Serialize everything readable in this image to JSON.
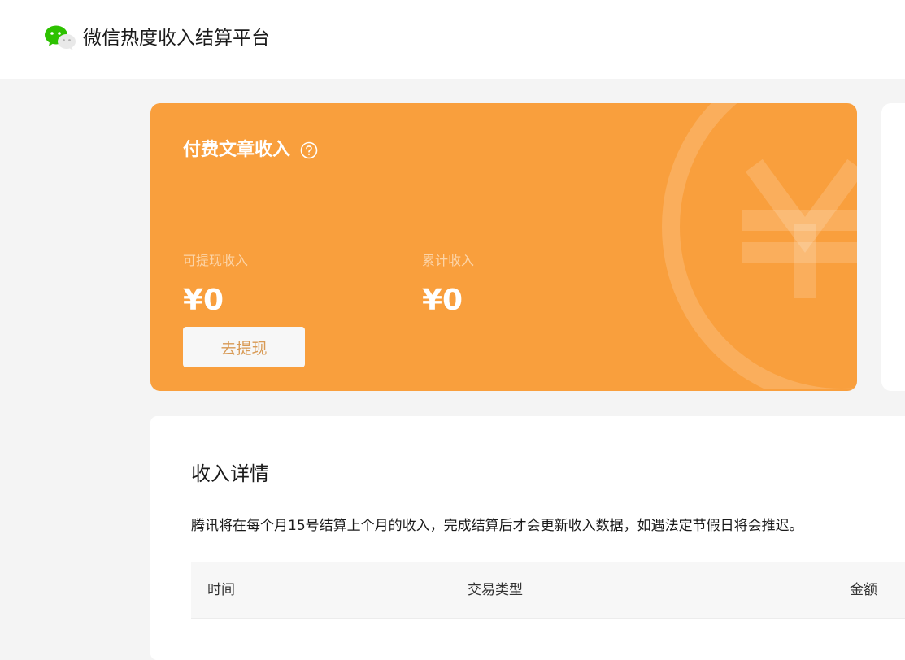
{
  "header": {
    "logo_icon": "wechat-logo-icon",
    "title": "微信热度收入结算平台"
  },
  "income_card": {
    "title": "付费文章收入",
    "help_icon": "question-circle-icon",
    "background_color": "#f99f3d",
    "watermark_icon": "yen-coin-icon",
    "available": {
      "label": "可提现收入",
      "value": "¥0"
    },
    "total": {
      "label": "累计收入",
      "value": "¥0"
    },
    "withdraw_button": "去提现"
  },
  "details": {
    "title": "收入详情",
    "note": "腾讯将在每个月15号结算上个月的收入，完成结算后才会更新收入数据，如遇法定节假日将会推迟。",
    "table": {
      "columns": [
        "时间",
        "交易类型",
        "金额"
      ],
      "rows": []
    }
  }
}
